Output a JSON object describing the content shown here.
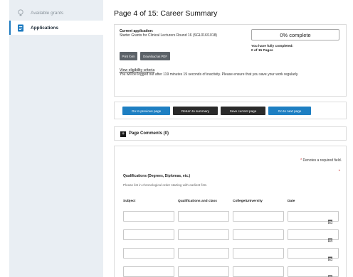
{
  "sidebar": {
    "items": [
      {
        "label": "Available grants",
        "icon": "lightbulb-icon"
      },
      {
        "label": "Applications",
        "icon": "document-icon"
      }
    ]
  },
  "header": {
    "title": "Page 4 of 15: Career Summary"
  },
  "application": {
    "current_label": "Current application:",
    "name": "Starter Grants for Clinical Lecturers Round 16 (SGL016\\1018)",
    "print_label": "Print form",
    "pdf_label": "Download as PDF",
    "progress_text": "0% complete",
    "progress_fraction": 0,
    "completed_label": "You have fully completed:",
    "completed_value": "0 of 15 Pages",
    "eligibility_link": "View eligibility criteria",
    "logout_text": "You will be logged out after 119 minutes 19 seconds of inactivity. Please ensure that you save your work regularly."
  },
  "nav": {
    "prev": "Go to previous page",
    "summary": "Return to summary",
    "save": "Save current page",
    "next": "Go to next page"
  },
  "comments": {
    "label": "Page Comments (0)"
  },
  "form": {
    "required_note": "Denotes a required field.",
    "required_star": "*",
    "qualifications_title": "Qualifications (Degrees, Diplomas, etc.)",
    "qualifications_hint": "Please list in chronological order starting with earliest first.",
    "columns": [
      "Subject",
      "Qualifications and class",
      "College/University",
      "Date"
    ],
    "rows": 4
  },
  "colors": {
    "accent": "#1e7fc2",
    "sidebar_bg": "#e9eef3",
    "dark_button": "#5c6268",
    "required": "#c62828"
  }
}
